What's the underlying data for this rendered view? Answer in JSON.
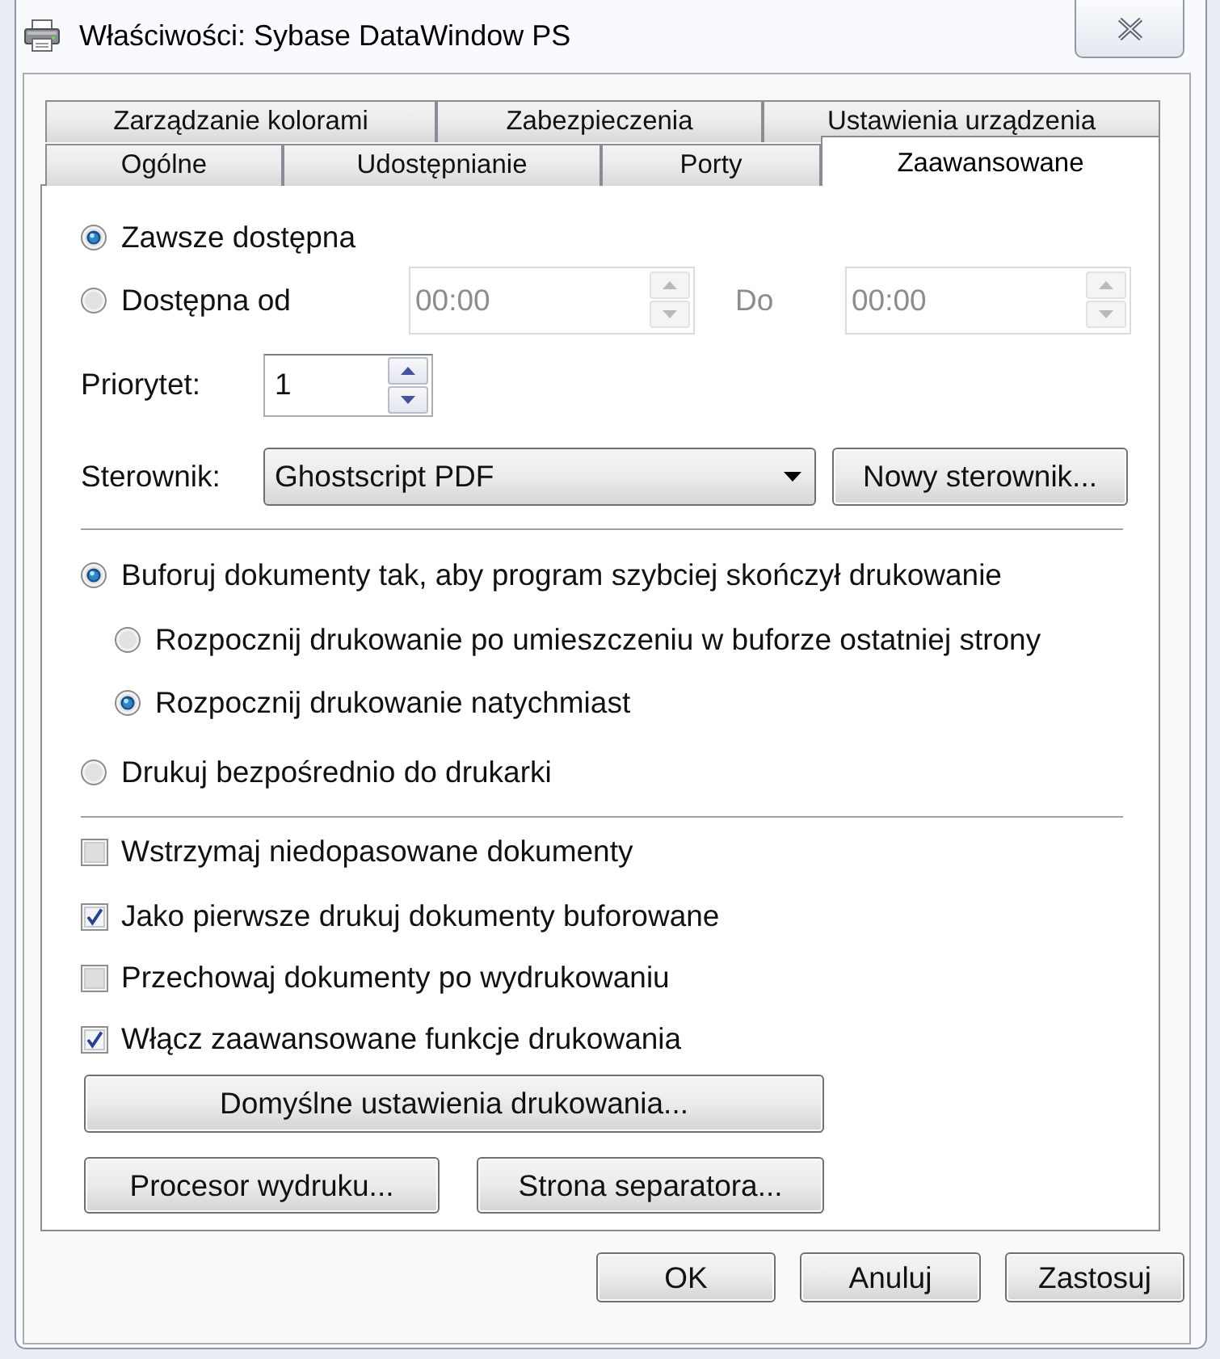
{
  "window": {
    "title": "Właściwości: Sybase DataWindow PS"
  },
  "tab_rows": [
    [
      {
        "label": "Zarządzanie kolorami",
        "selected": false
      },
      {
        "label": "Zabezpieczenia",
        "selected": false
      },
      {
        "label": "Ustawienia urządzenia",
        "selected": false
      }
    ],
    [
      {
        "label": "Ogólne",
        "selected": false
      },
      {
        "label": "Udostępnianie",
        "selected": false
      },
      {
        "label": "Porty",
        "selected": false
      },
      {
        "label": "Zaawansowane",
        "selected": true
      }
    ]
  ],
  "availability": {
    "options": [
      {
        "label": "Zawsze dostępna",
        "selected": true
      },
      {
        "label": "Dostępna od",
        "selected": false
      }
    ],
    "time_range": {
      "disabled": true,
      "from": "00:00",
      "to_label": "Do",
      "to": "00:00"
    }
  },
  "priority": {
    "label": "Priorytet:",
    "value": "1"
  },
  "driver": {
    "label": "Sterownik:",
    "value": "Ghostscript PDF",
    "button": "Nowy sterownik..."
  },
  "spooling": [
    {
      "label": "Buforuj dokumenty tak, aby program szybciej skończył drukowanie",
      "selected": true,
      "children": [
        {
          "label": "Rozpocznij drukowanie po umieszczeniu w buforze ostatniej strony",
          "selected": false
        },
        {
          "label": "Rozpocznij drukowanie natychmiast",
          "selected": true
        }
      ]
    },
    {
      "label": "Drukuj bezpośrednio do drukarki",
      "selected": false
    }
  ],
  "options": [
    {
      "label": "Wstrzymaj niedopasowane dokumenty",
      "checked": false
    },
    {
      "label": "Jako pierwsze drukuj dokumenty buforowane",
      "checked": true
    },
    {
      "label": "Przechowaj dokumenty po wydrukowaniu",
      "checked": false
    },
    {
      "label": "Włącz zaawansowane funkcje drukowania",
      "checked": true
    }
  ],
  "panel_buttons": [
    [
      "Domyślne ustawienia drukowania..."
    ],
    [
      "Procesor wydruku...",
      "Strona separatora..."
    ]
  ],
  "dialog_buttons": [
    "OK",
    "Anuluj",
    "Zastosuj"
  ]
}
